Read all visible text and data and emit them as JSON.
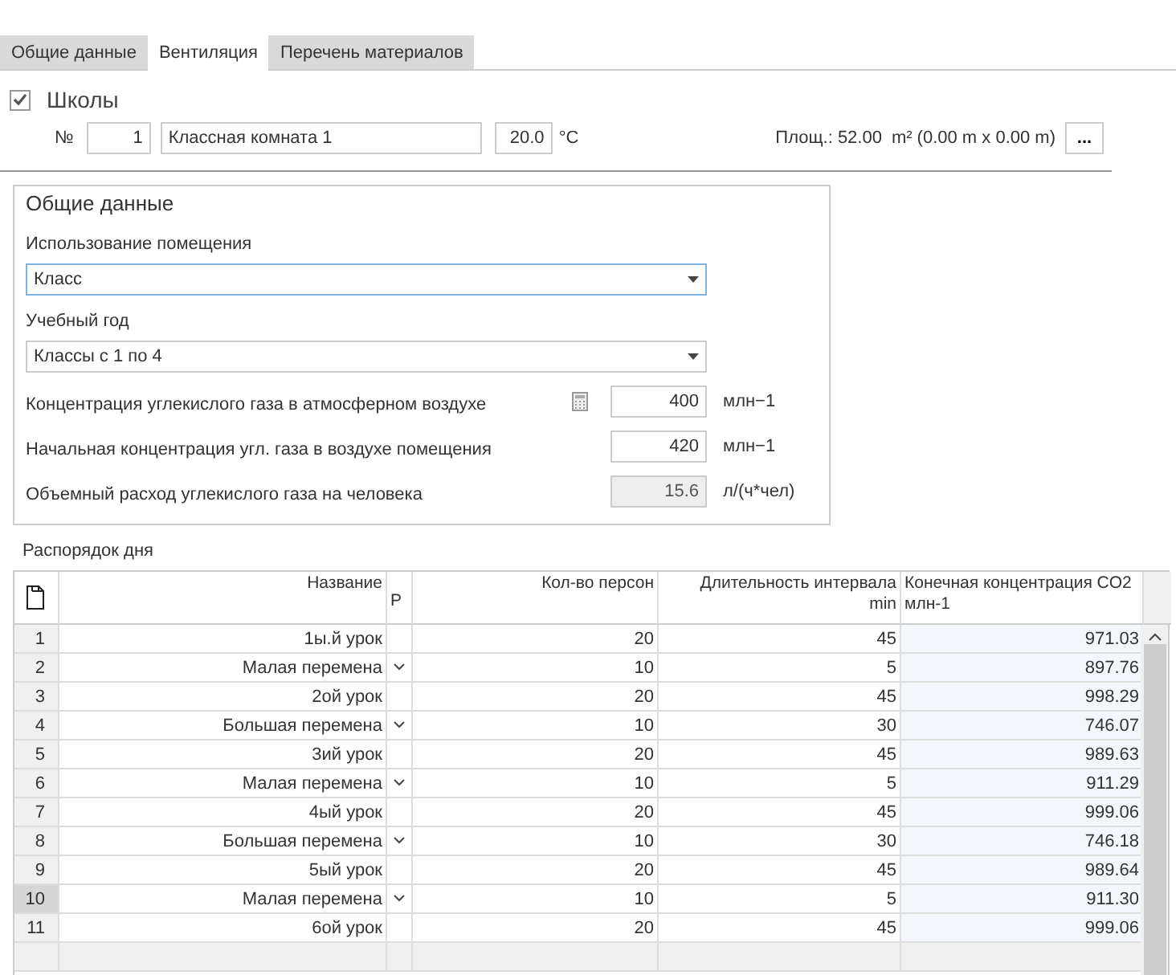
{
  "tabs": [
    {
      "label": "Общие данные",
      "selected": false
    },
    {
      "label": "Вентиляция",
      "selected": true
    },
    {
      "label": "Перечень материалов",
      "selected": false
    }
  ],
  "category": {
    "label": "Школы",
    "checked": true
  },
  "room": {
    "number_label": "№",
    "number": "1",
    "name": "Классная комната 1",
    "temperature": "20.0",
    "temperature_unit": "°C",
    "area_label": "Площ.: 52.00",
    "area_unit": "m²",
    "dimensions": "(0.00 m x 0.00 m)",
    "more_button": "..."
  },
  "general": {
    "title": "Общие данные",
    "fields": [
      {
        "kind": "select",
        "label": "Использование помещения",
        "value": "Класс",
        "focused": true
      },
      {
        "kind": "select",
        "label": "Учебный год",
        "value": "Классы с 1 по 4",
        "focused": false
      },
      {
        "kind": "number",
        "label": "Концентрация углекислого газа в атмосферном воздухе",
        "value": "400",
        "unit": "млн−1",
        "calculator": true,
        "disabled": false
      },
      {
        "kind": "number",
        "label": "Начальная концентрация угл. газа в воздухе помещения",
        "value": "420",
        "unit": "млн−1",
        "calculator": false,
        "disabled": false
      },
      {
        "kind": "number",
        "label": "Объемный расход углекислого газа на человека",
        "value": "15.6",
        "unit": "л/(ч*чел)",
        "calculator": false,
        "disabled": true
      }
    ]
  },
  "schedule": {
    "title": "Распорядок дня",
    "columns": [
      {
        "label": "Название"
      },
      {
        "label": "Р"
      },
      {
        "label": "Кол-во персон"
      },
      {
        "label": "Длительность интервала",
        "unit": "min"
      },
      {
        "label": "Конечная концентрация CO2",
        "unit": "млн-1"
      }
    ],
    "rows": [
      {
        "number": "1",
        "name": "1ы.й урок",
        "dropdown": false,
        "persons": "20",
        "duration": "45",
        "co2": "971.03",
        "selected": false
      },
      {
        "number": "2",
        "name": "Малая перемена",
        "dropdown": true,
        "persons": "10",
        "duration": "5",
        "co2": "897.76",
        "selected": false
      },
      {
        "number": "3",
        "name": "2ой урок",
        "dropdown": false,
        "persons": "20",
        "duration": "45",
        "co2": "998.29",
        "selected": false
      },
      {
        "number": "4",
        "name": "Большая перемена",
        "dropdown": true,
        "persons": "10",
        "duration": "30",
        "co2": "746.07",
        "selected": false
      },
      {
        "number": "5",
        "name": "3ий урок",
        "dropdown": false,
        "persons": "20",
        "duration": "45",
        "co2": "989.63",
        "selected": false
      },
      {
        "number": "6",
        "name": "Малая перемена",
        "dropdown": true,
        "persons": "10",
        "duration": "5",
        "co2": "911.29",
        "selected": false
      },
      {
        "number": "7",
        "name": "4ый урок",
        "dropdown": false,
        "persons": "20",
        "duration": "45",
        "co2": "999.06",
        "selected": false
      },
      {
        "number": "8",
        "name": "Большая перемена",
        "dropdown": true,
        "persons": "10",
        "duration": "30",
        "co2": "746.18",
        "selected": false
      },
      {
        "number": "9",
        "name": "5ый урок",
        "dropdown": false,
        "persons": "20",
        "duration": "45",
        "co2": "989.64",
        "selected": false
      },
      {
        "number": "10",
        "name": "Малая перемена",
        "dropdown": true,
        "persons": "10",
        "duration": "5",
        "co2": "911.30",
        "selected": true
      },
      {
        "number": "11",
        "name": "6ой урок",
        "dropdown": false,
        "persons": "20",
        "duration": "45",
        "co2": "999.06",
        "selected": false
      }
    ]
  }
}
